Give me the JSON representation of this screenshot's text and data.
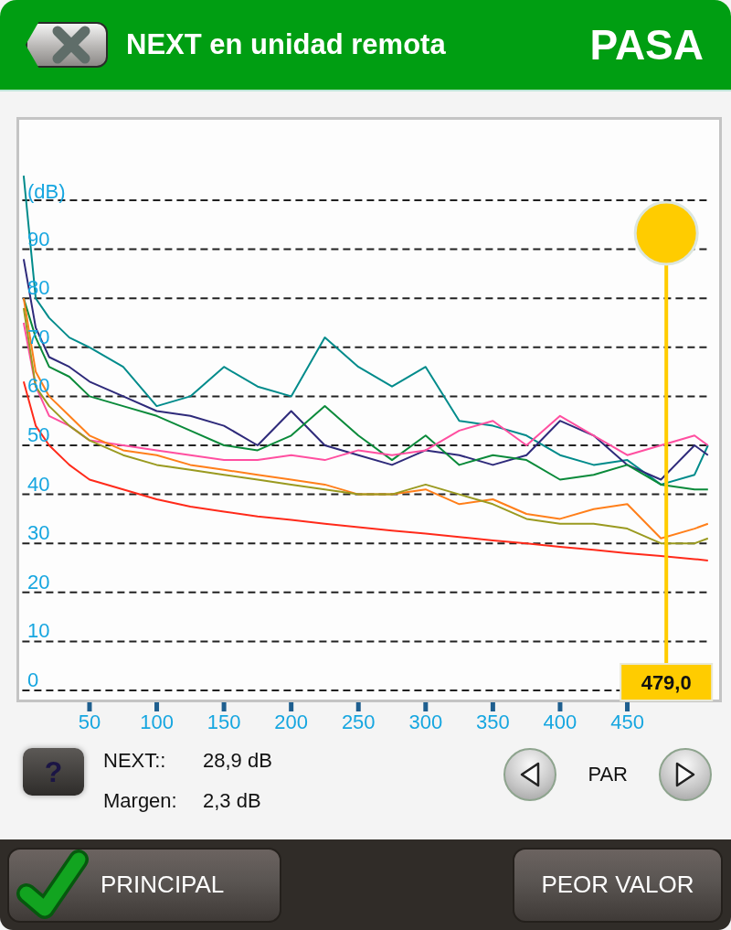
{
  "header": {
    "title": "NEXT en unidad remota",
    "result": {
      "text": "PASA",
      "kind": "pass"
    }
  },
  "chart": {
    "chart_data": {
      "type": "line",
      "ylabel": "(dB)",
      "x": [
        1,
        10,
        20,
        35,
        50,
        75,
        100,
        125,
        150,
        175,
        200,
        225,
        250,
        275,
        300,
        325,
        350,
        375,
        400,
        425,
        450,
        475,
        500,
        510
      ],
      "series": [
        {
          "color": "#008b8b",
          "values": [
            105,
            80,
            76,
            72,
            70,
            66,
            58,
            60,
            66,
            62,
            60,
            72,
            66,
            62,
            66,
            55,
            54,
            52,
            48,
            46,
            47,
            42,
            44,
            50
          ]
        },
        {
          "color": "#2e2a7a",
          "values": [
            88,
            74,
            68,
            66,
            63,
            60,
            57,
            56,
            54,
            50,
            57,
            50,
            48,
            46,
            49,
            48,
            46,
            48,
            55,
            52,
            46,
            43,
            50,
            48
          ]
        },
        {
          "color": "#0a8a3a",
          "values": [
            80,
            72,
            66,
            64,
            60,
            58,
            56,
            53,
            50,
            49,
            52,
            58,
            52,
            47,
            52,
            46,
            48,
            47,
            43,
            44,
            46,
            42,
            41,
            41
          ]
        },
        {
          "color": "#ff4fa0",
          "values": [
            75,
            62,
            56,
            54,
            51,
            50,
            49,
            48,
            47,
            47,
            48,
            47,
            49,
            48,
            49,
            53,
            55,
            50,
            56,
            52,
            48,
            50,
            52,
            50
          ]
        },
        {
          "color": "#ff7f1a",
          "values": [
            80,
            65,
            60,
            56,
            52,
            49,
            48,
            46,
            45,
            44,
            43,
            42,
            40,
            40,
            41,
            38,
            39,
            36,
            35,
            37,
            38,
            31,
            33,
            34
          ]
        },
        {
          "color": "#9a9a20",
          "values": [
            78,
            62,
            58,
            54,
            51,
            48,
            46,
            45,
            44,
            43,
            42,
            41,
            40,
            40,
            42,
            40,
            38,
            35,
            34,
            34,
            33,
            30,
            30,
            31
          ]
        },
        {
          "color": "#ff2a1a",
          "values": [
            63,
            54,
            50,
            46,
            43,
            41,
            39,
            37.5,
            36.5,
            35.5,
            34.8,
            34,
            33.3,
            32.6,
            32,
            31.3,
            30.6,
            30,
            29.3,
            28.7,
            28,
            27.4,
            26.8,
            26.5
          ]
        }
      ],
      "xlim": [
        0,
        510
      ],
      "ylim": [
        0,
        116.7
      ],
      "xticks": [
        50,
        100,
        150,
        200,
        250,
        300,
        350,
        400,
        450
      ],
      "yticks": [
        0,
        10,
        20,
        30,
        40,
        50,
        60,
        70,
        80,
        90
      ],
      "grid": true,
      "ref_lines": [
        {
          "axis": "x",
          "value": 479,
          "label": "479,0",
          "color": "#ffcc00"
        }
      ]
    }
  },
  "help_button": {
    "label": "?"
  },
  "readings": [
    {
      "label": "NEXT::",
      "value": "28,9 dB"
    },
    {
      "label": "Margen:",
      "value": "2,3 dB"
    }
  ],
  "pair_selector": {
    "label": "PAR"
  },
  "footer_buttons": [
    {
      "label": "PRINCIPAL",
      "kind": "check"
    },
    {
      "label": "PEOR VALOR",
      "kind": "plain"
    }
  ]
}
